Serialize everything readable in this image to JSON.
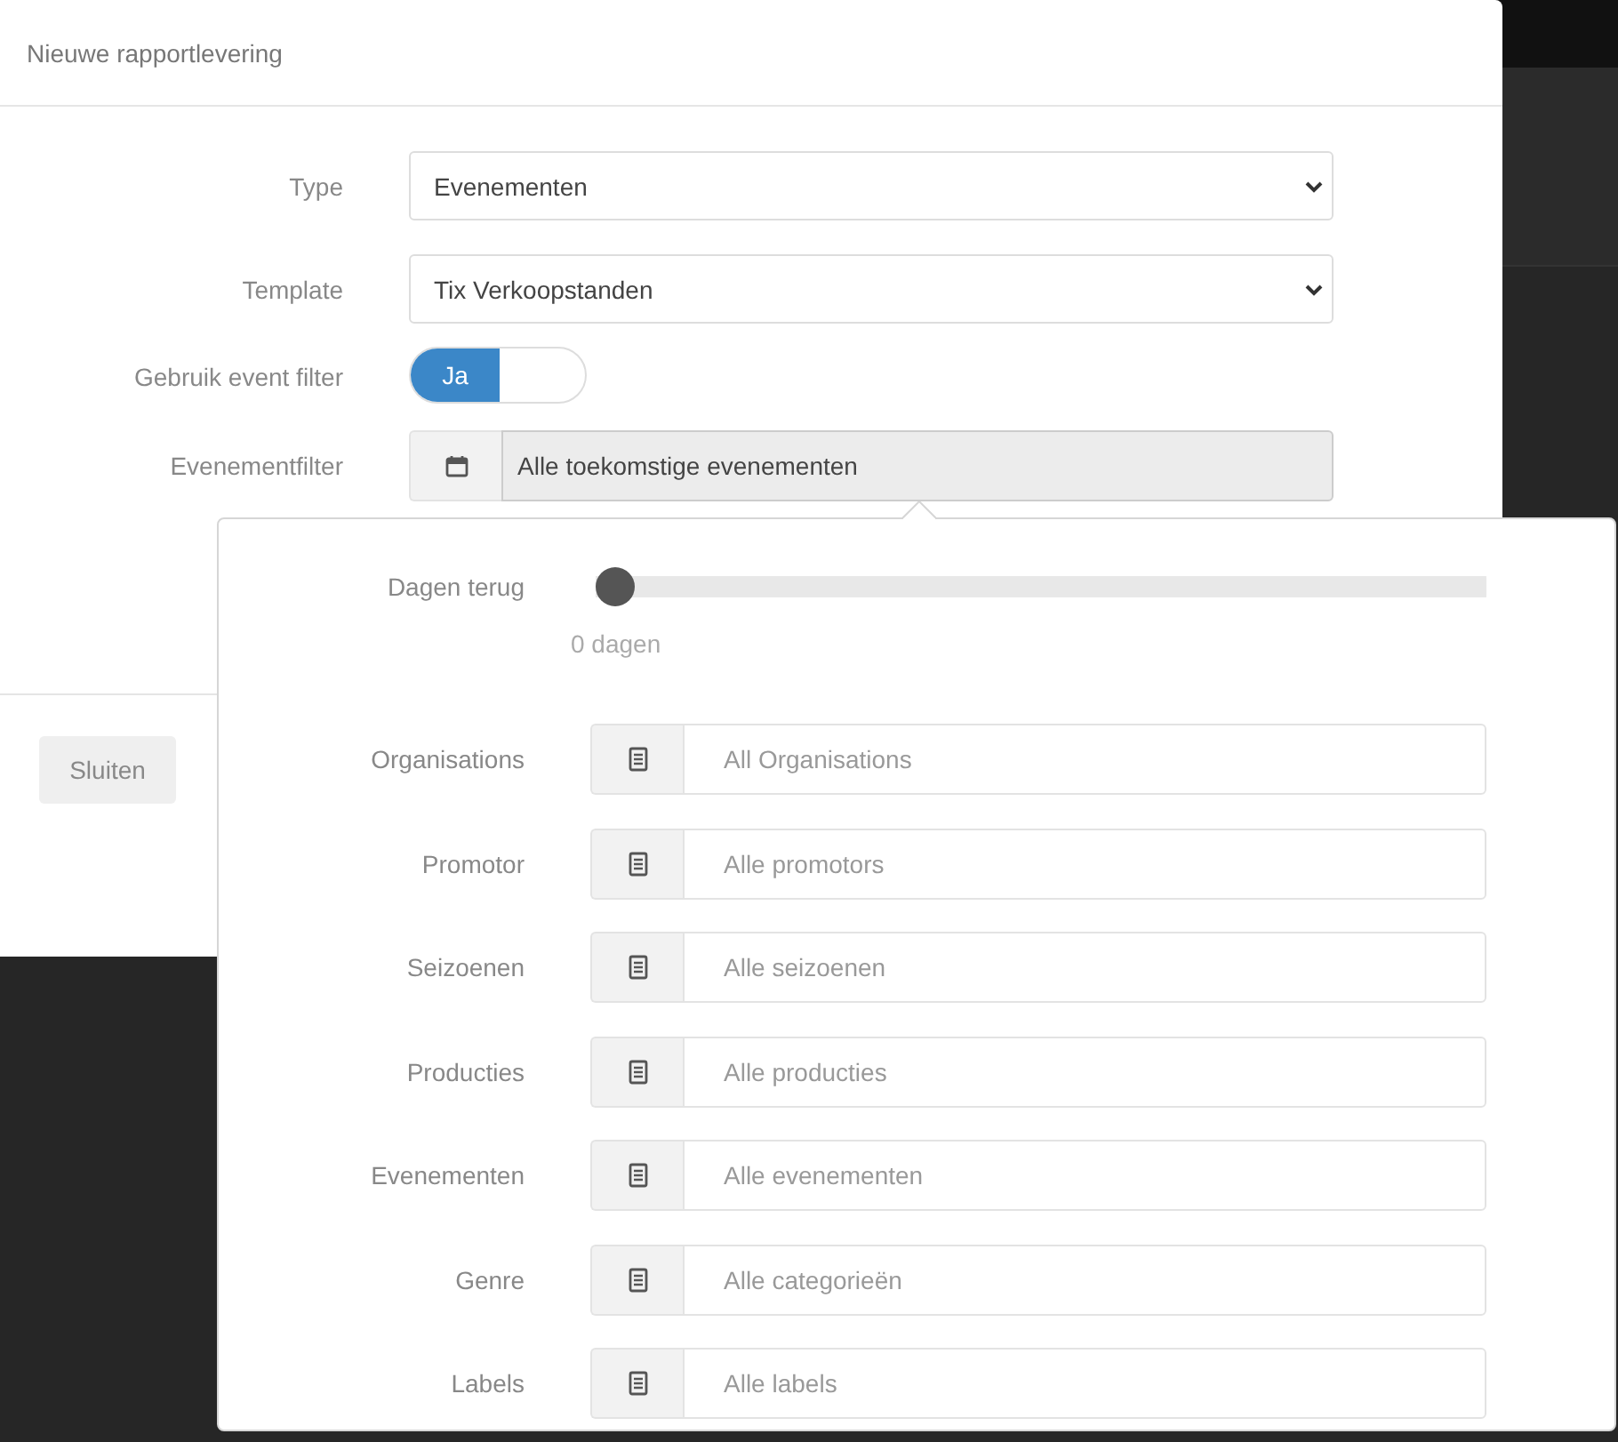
{
  "dialog": {
    "title": "Nieuwe rapportlevering"
  },
  "form": {
    "rows": [
      {
        "kind": "select",
        "label": "Type",
        "value": "Evenementen"
      },
      {
        "kind": "select",
        "label": "Template",
        "value": "Tix Verkoopstanden"
      },
      {
        "kind": "toggle",
        "label": "Gebruik event filter",
        "value": "Ja",
        "on": true
      },
      {
        "kind": "picker",
        "label": "Evenementfilter",
        "value": "Alle toekomstige evenementen"
      }
    ]
  },
  "filter_popover": {
    "slider": {
      "label": "Dagen terug",
      "level": 0,
      "reading": "0 dagen"
    },
    "fields": [
      {
        "label": "Organisations",
        "placeholder": "All Organisations"
      },
      {
        "label": "Promotor",
        "placeholder": "Alle promotors"
      },
      {
        "label": "Seizoenen",
        "placeholder": "Alle seizoenen"
      },
      {
        "label": "Producties",
        "placeholder": "Alle producties"
      },
      {
        "label": "Evenementen",
        "placeholder": "Alle evenementen"
      },
      {
        "label": "Genre",
        "placeholder": "Alle categorieën"
      },
      {
        "label": "Labels",
        "placeholder": "Alle labels"
      }
    ]
  },
  "footer": {
    "buttons": [
      "Sluiten"
    ]
  }
}
